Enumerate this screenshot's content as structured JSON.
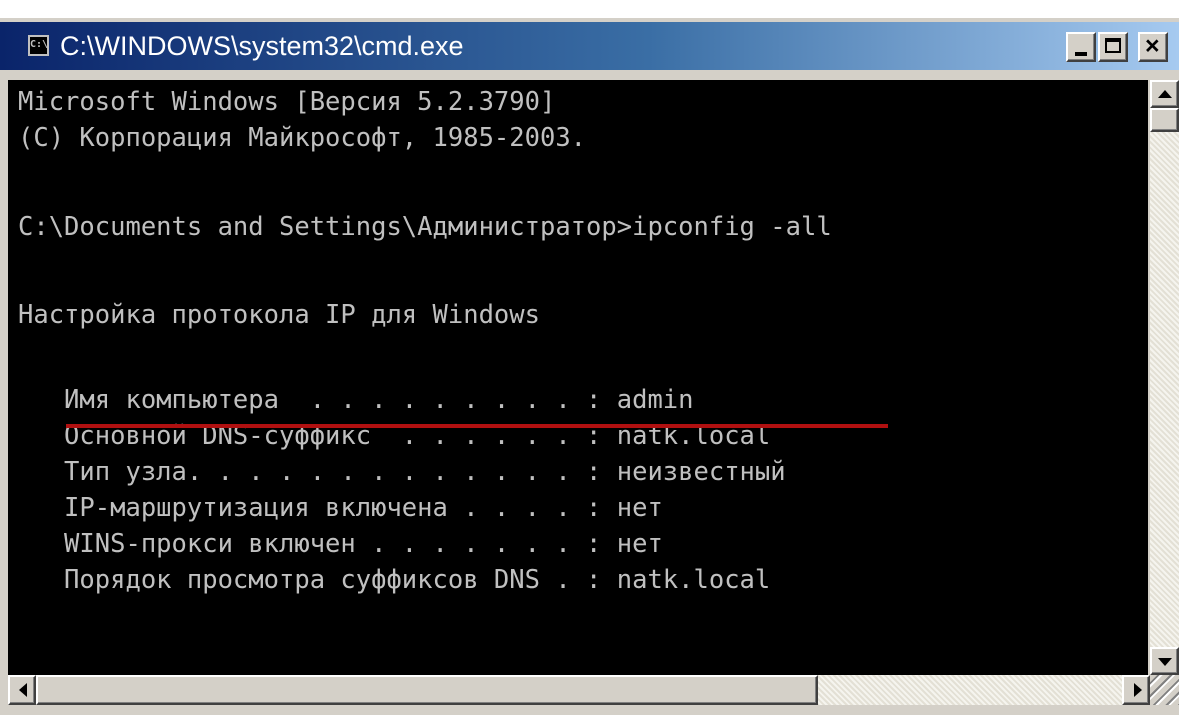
{
  "window": {
    "title": "C:\\WINDOWS\\system32\\cmd.exe",
    "icon": "cmd-icon",
    "controls": {
      "minimize": "minimize-icon",
      "maximize": "maximize-icon",
      "close": "close-icon"
    }
  },
  "console": {
    "lines": [
      "Microsoft Windows [Версия 5.2.3790]",
      "(C) Корпорация Майкрософт, 1985-2003.",
      "",
      "C:\\Documents and Settings\\Администратор>ipconfig -all",
      "",
      "Настройка протокола IP для Windows",
      "",
      "   Имя компьютера  . . . . . . . . . : admin",
      "   Основной DNS-суффикс  . . . . . . : natk.local",
      "   Тип узла. . . . . . . . . . . . . : неизвестный",
      "   IP-маршрутизация включена . . . . : нет",
      "   WINS-прокси включен . . . . . . . : нет",
      "   Порядок просмотра суффиксов DNS . : natk.local"
    ],
    "text_color": "#c0c0c0",
    "background": "#000000",
    "highlight_color": "#b01010"
  },
  "colors": {
    "titlebar_start": "#0a246a",
    "titlebar_end": "#a6caf0",
    "frame": "#d4d0c8"
  }
}
